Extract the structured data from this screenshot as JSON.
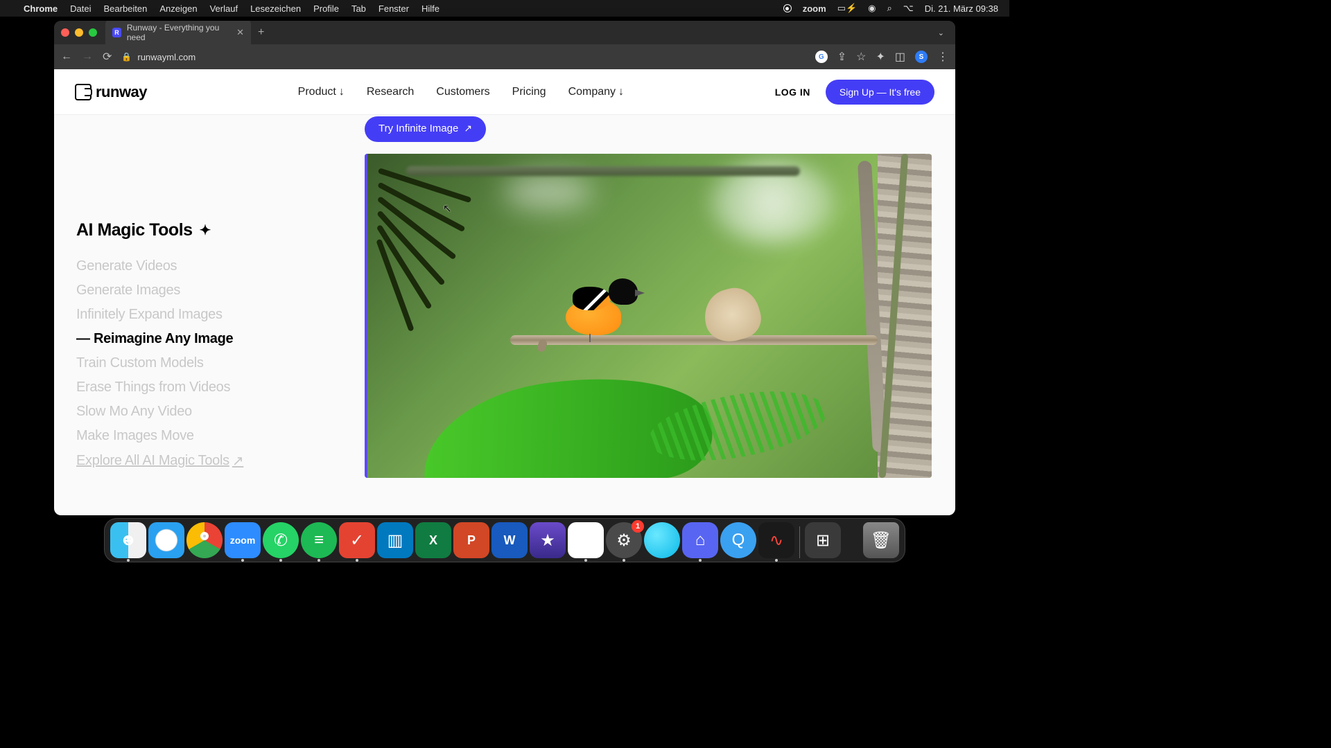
{
  "menubar": {
    "app": "Chrome",
    "items": [
      "Datei",
      "Bearbeiten",
      "Anzeigen",
      "Verlauf",
      "Lesezeichen",
      "Profile",
      "Tab",
      "Fenster",
      "Hilfe"
    ],
    "zoom": "zoom",
    "datetime": "Di. 21. März  09:38"
  },
  "browser": {
    "tab_title": "Runway - Everything you need",
    "url": "runwayml.com"
  },
  "header": {
    "logo_text": "runway",
    "nav": {
      "product": "Product",
      "research": "Research",
      "customers": "Customers",
      "pricing": "Pricing",
      "company": "Company"
    },
    "login": "LOG IN",
    "signup": "Sign Up — It's free"
  },
  "cta": {
    "label": "Try Infinite Image"
  },
  "sidebar": {
    "title": "AI Magic Tools",
    "items": [
      "Generate Videos",
      "Generate Images",
      "Infinitely Expand Images",
      "Reimagine Any Image",
      "Train Custom Models",
      "Erase Things from Videos",
      "Slow Mo Any Video",
      "Make Images Move"
    ],
    "active_index": 3,
    "explore": "Explore All AI Magic Tools"
  },
  "dock": {
    "badge_settings": "1",
    "zoom_label": "zoom"
  },
  "avatar_initial": "S"
}
